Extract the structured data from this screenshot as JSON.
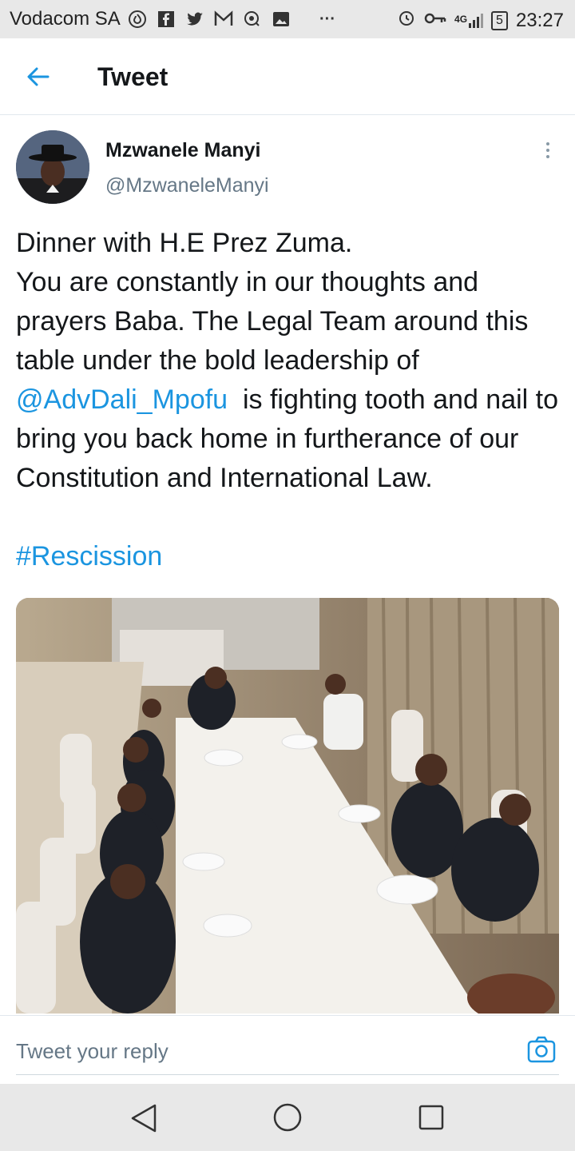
{
  "status_bar": {
    "carrier": "Vodacom SA",
    "network": "4G",
    "battery": "5",
    "time": "23:27",
    "icons": [
      "fire-icon",
      "facebook-icon",
      "twitter-icon",
      "mail-icon",
      "scan-icon",
      "image-icon",
      "more-dots-icon",
      "alarm-icon",
      "key-icon",
      "signal-icon",
      "battery-icon"
    ]
  },
  "header": {
    "title": "Tweet"
  },
  "tweet": {
    "author_name": "Mzwanele Manyi",
    "author_handle": "@MzwaneleManyi",
    "text_before": "Dinner with H.E Prez Zuma.\nYou are constantly in our thoughts and prayers Baba. The Legal Team around this table under the bold leadership of ",
    "mention": "@AdvDali_Mpofu",
    "text_after": "  is fighting tooth and nail to bring you back home in furtherance of our Constitution and International Law.",
    "hashtag": "#Rescission"
  },
  "reply": {
    "placeholder": "Tweet your reply"
  },
  "colors": {
    "link": "#1b95e0",
    "secondary": "#657786",
    "bars": "#e8e8e8"
  }
}
